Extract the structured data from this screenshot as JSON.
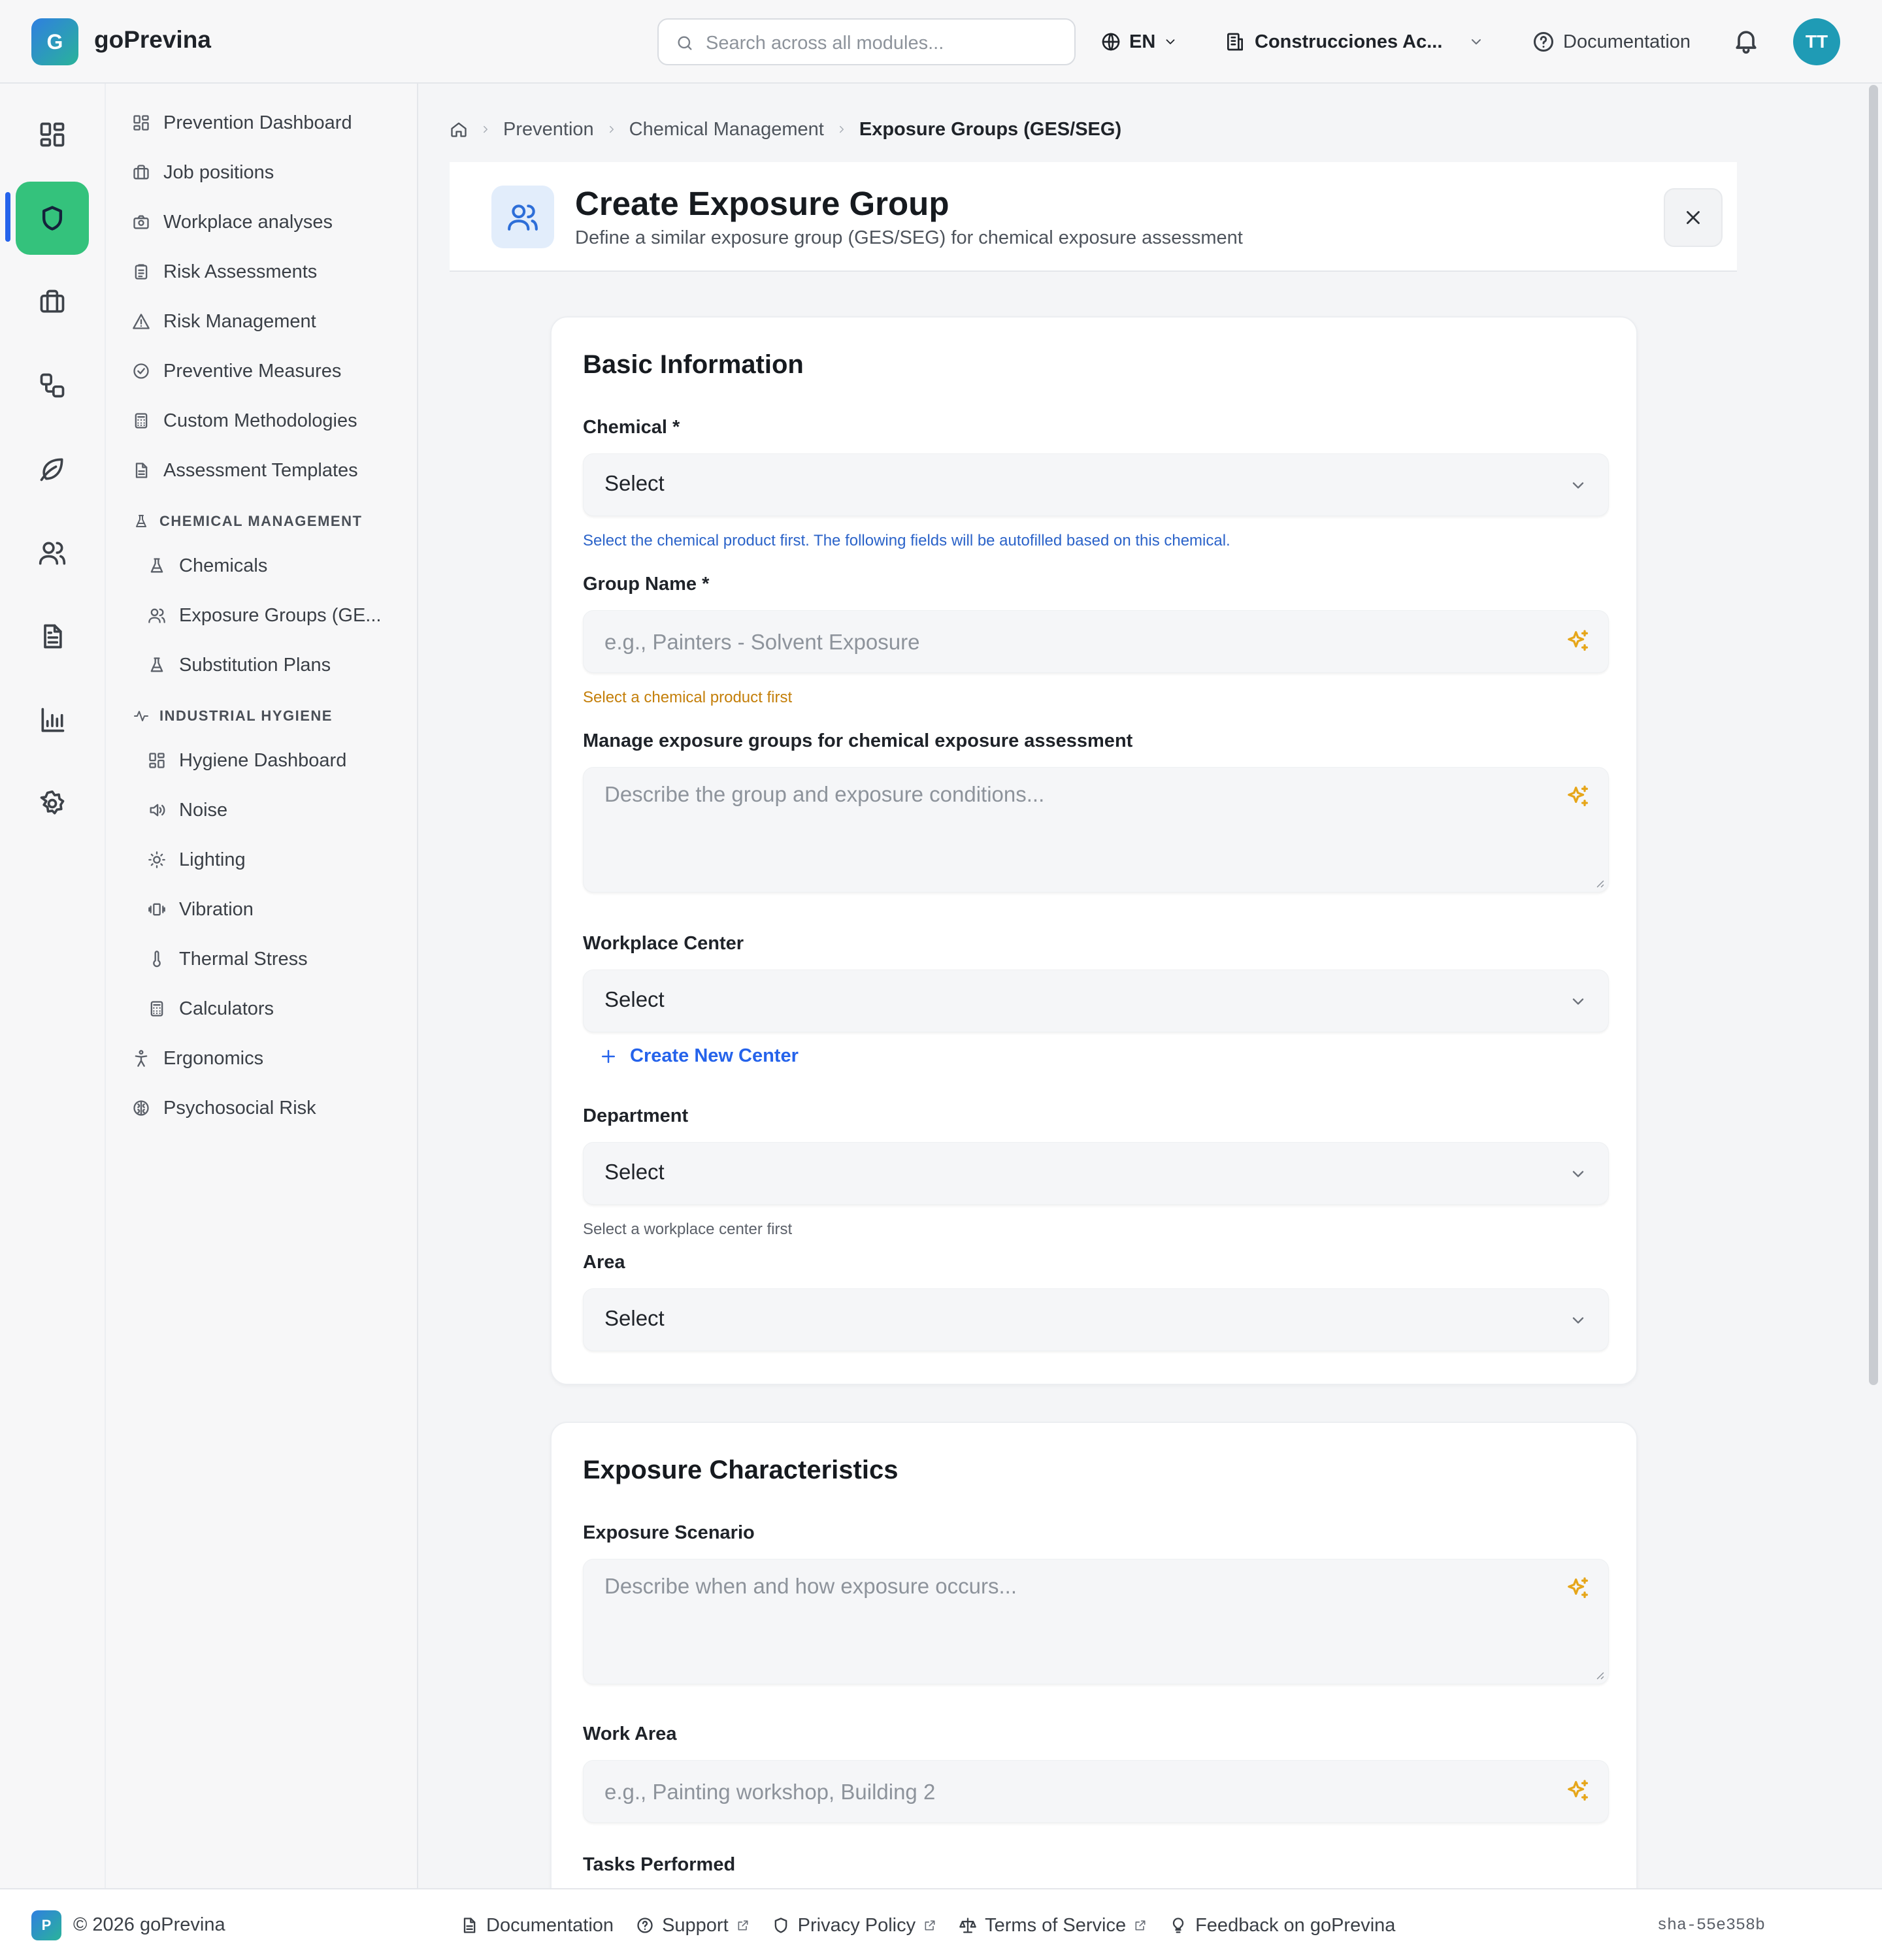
{
  "app": {
    "logo_letter": "G",
    "name": "goPrevina"
  },
  "topbar": {
    "search_placeholder": "Search across all modules...",
    "language": "EN",
    "company": "Construcciones Ac...",
    "documentation": "Documentation",
    "user_initials": "TT"
  },
  "rail": {
    "items": [
      {
        "icon": "dashboard-icon"
      },
      {
        "icon": "shield-icon",
        "active": true
      },
      {
        "icon": "briefcase-icon"
      },
      {
        "icon": "shapes-icon"
      },
      {
        "icon": "leaf-icon"
      },
      {
        "icon": "users-icon"
      },
      {
        "icon": "document-icon"
      },
      {
        "icon": "bar-chart-icon"
      },
      {
        "icon": "gear-icon"
      }
    ]
  },
  "sidenav": {
    "items": [
      {
        "label": "Prevention Dashboard",
        "icon": "dashboard-icon"
      },
      {
        "label": "Job positions",
        "icon": "briefcase-icon"
      },
      {
        "label": "Workplace analyses",
        "icon": "camera-icon"
      },
      {
        "label": "Risk Assessments",
        "icon": "clipboard-icon"
      },
      {
        "label": "Risk Management",
        "icon": "warning-icon"
      },
      {
        "label": "Preventive Measures",
        "icon": "check-circle-icon"
      },
      {
        "label": "Custom Methodologies",
        "icon": "calculator-icon"
      },
      {
        "label": "Assessment Templates",
        "icon": "file-icon"
      }
    ],
    "chemical_section": "CHEMICAL MANAGEMENT",
    "chemical_items": [
      {
        "label": "Chemicals",
        "icon": "flask-icon"
      },
      {
        "label": "Exposure Groups (GE...",
        "icon": "users-icon"
      },
      {
        "label": "Substitution Plans",
        "icon": "flask-icon"
      }
    ],
    "hygiene_section": "INDUSTRIAL HYGIENE",
    "hygiene_items": [
      {
        "label": "Hygiene Dashboard",
        "icon": "dashboard-icon"
      },
      {
        "label": "Noise",
        "icon": "speaker-icon"
      },
      {
        "label": "Lighting",
        "icon": "sun-icon"
      },
      {
        "label": "Vibration",
        "icon": "vibration-icon"
      },
      {
        "label": "Thermal Stress",
        "icon": "thermometer-icon"
      },
      {
        "label": "Calculators",
        "icon": "calculator-icon"
      }
    ],
    "bottom_items": [
      {
        "label": "Ergonomics",
        "icon": "person-icon"
      },
      {
        "label": "Psychosocial Risk",
        "icon": "brain-icon"
      }
    ]
  },
  "breadcrumb": [
    "Prevention",
    "Chemical Management",
    "Exposure Groups (GES/SEG)"
  ],
  "page": {
    "title": "Create Exposure Group",
    "subtitle": "Define a similar exposure group (GES/SEG) for chemical exposure assessment"
  },
  "basic": {
    "title": "Basic Information",
    "chemical_label": "Chemical *",
    "chemical_value": "Select",
    "chemical_hint": "Select the chemical product first. The following fields will be autofilled based on this chemical.",
    "group_name_label": "Group Name *",
    "group_name_placeholder": "e.g., Painters - Solvent Exposure",
    "group_name_hint": "Select a chemical product first",
    "description_label": "Manage exposure groups for chemical exposure assessment",
    "description_placeholder": "Describe the group and exposure conditions...",
    "workplace_label": "Workplace Center",
    "workplace_value": "Select",
    "create_center": "Create New Center",
    "department_label": "Department",
    "department_value": "Select",
    "department_hint": "Select a workplace center first",
    "area_label": "Area",
    "area_value": "Select"
  },
  "exposure": {
    "title": "Exposure Characteristics",
    "scenario_label": "Exposure Scenario",
    "scenario_placeholder": "Describe when and how exposure occurs...",
    "work_area_label": "Work Area",
    "work_area_placeholder": "e.g., Painting workshop, Building 2",
    "tasks_label": "Tasks Performed"
  },
  "footer": {
    "logo_letter": "P",
    "copyright": "© 2026 goPrevina",
    "links": [
      {
        "label": "Documentation",
        "icon": "file-icon",
        "external": false
      },
      {
        "label": "Support",
        "icon": "help-icon",
        "external": true
      },
      {
        "label": "Privacy Policy",
        "icon": "shield-icon",
        "external": true
      },
      {
        "label": "Terms of Service",
        "icon": "scale-icon",
        "external": true
      },
      {
        "label": "Feedback on goPrevina",
        "icon": "lightbulb-icon",
        "external": false
      }
    ],
    "version": "sha-55e358b"
  }
}
